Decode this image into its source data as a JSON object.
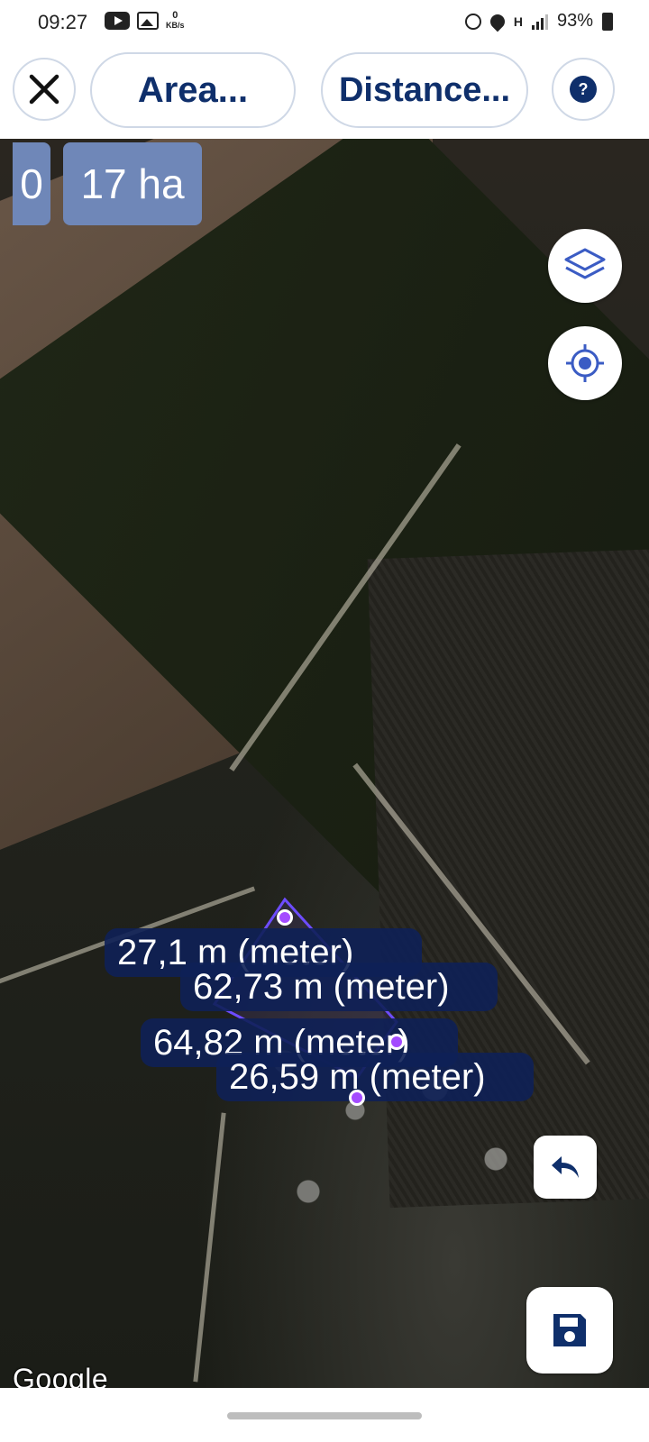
{
  "status_bar": {
    "time": "09:27",
    "data_rate_value": "0",
    "data_rate_unit": "KB/s",
    "network_type": "H",
    "battery": "93%"
  },
  "toolbar": {
    "area_label": "Area...",
    "distance_label": "Distance...",
    "help_label": "?"
  },
  "area_readout": {
    "left_value": "0",
    "area_value": "17 ha"
  },
  "measurements": [
    "27,1 m (meter)",
    "62,73 m (meter)",
    "64,82 m (meter)",
    "26,59 m (meter)"
  ],
  "map": {
    "attribution": "Google"
  },
  "colors": {
    "primary": "#0f2f6b",
    "badge": "#6f87b8",
    "label_bg": "#0e2056",
    "vertex": "#a44bff"
  }
}
